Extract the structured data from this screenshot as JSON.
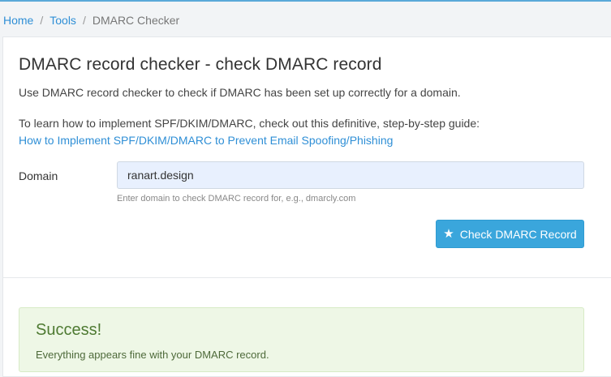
{
  "breadcrumb": {
    "home": "Home",
    "separator": "/",
    "tools": "Tools",
    "current": "DMARC Checker"
  },
  "page": {
    "title": "DMARC record checker - check DMARC record",
    "description": "Use DMARC record checker to check if DMARC has been set up correctly for a domain.",
    "learn_text": "To learn how to implement SPF/DKIM/DMARC, check out this definitive, step-by-step guide:",
    "guide_link": "How to Implement SPF/DKIM/DMARC to Prevent Email Spoofing/Phishing"
  },
  "form": {
    "domain_label": "Domain",
    "domain_value": "ranart.design",
    "help_text": "Enter domain to check DMARC record for, e.g., dmarcly.com",
    "button_icon": "star-icon",
    "button_label": "Check DMARC Record"
  },
  "result": {
    "title": "Success!",
    "message": "Everything appears fine with your DMARC record."
  },
  "colors": {
    "accent": "#3aa6dc",
    "link": "#2f8fd6",
    "success_bg": "#eef7e6",
    "success_text": "#4e7a32"
  }
}
